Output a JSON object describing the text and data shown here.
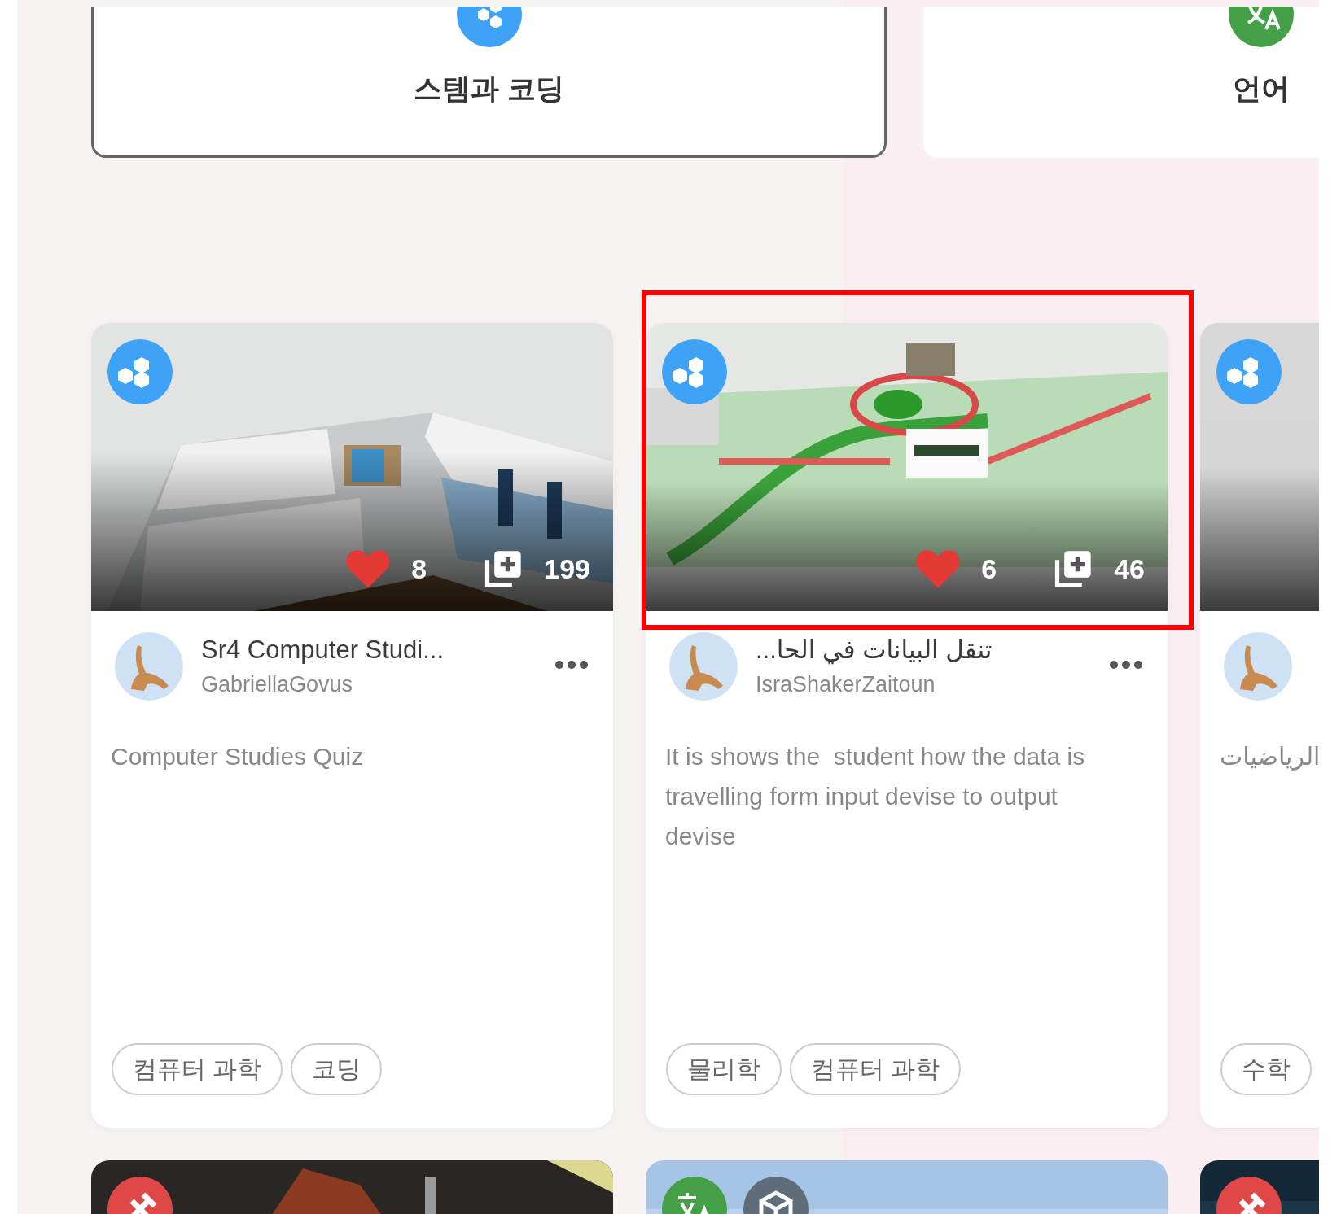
{
  "categories": [
    {
      "label": "스템과 코딩",
      "kind": "stem",
      "selected": true
    },
    {
      "label": "언어",
      "kind": "language",
      "selected": false
    }
  ],
  "cards": [
    {
      "kind": "stem",
      "likes": "8",
      "copies": "199",
      "title": "Sr4 Computer Studi...",
      "author": "GabriellaGovus",
      "description": "Computer Studies Quiz",
      "tags": [
        "컴퓨터 과학",
        "코딩"
      ],
      "highlighted": false
    },
    {
      "kind": "stem",
      "likes": "6",
      "copies": "46",
      "title": "تنقل البيانات في الحا...",
      "author": "IsraShakerZaitoun",
      "description": "It is shows the  student how the data is travelling form input devise to output devise",
      "tags": [
        "물리학",
        "컴퓨터 과학"
      ],
      "highlighted": true
    },
    {
      "kind": "stem",
      "description": "الرياضيات",
      "tags": [
        "수학"
      ],
      "highlighted": false
    }
  ],
  "more_cards": [
    {
      "badges": [
        {
          "kind": "tools"
        }
      ]
    },
    {
      "badges": [
        {
          "kind": "language"
        },
        {
          "kind": "cube"
        }
      ]
    },
    {
      "badges": [
        {
          "kind": "tools"
        }
      ]
    }
  ]
}
